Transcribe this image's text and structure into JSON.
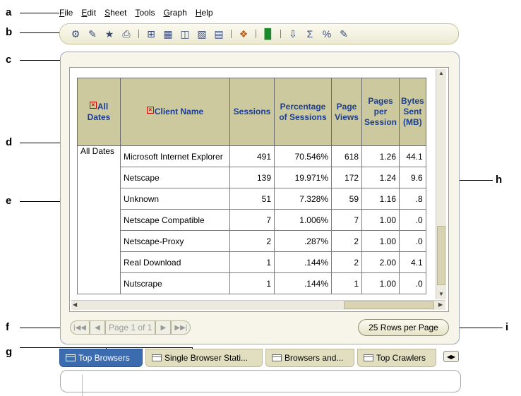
{
  "callouts": [
    "a",
    "b",
    "c",
    "d",
    "e",
    "f",
    "g",
    "h",
    "i"
  ],
  "menu": [
    {
      "underline": "F",
      "rest": "ile"
    },
    {
      "underline": "E",
      "rest": "dit"
    },
    {
      "underline": "S",
      "rest": "heet"
    },
    {
      "underline": "T",
      "rest": "ools"
    },
    {
      "underline": "G",
      "rest": "raph"
    },
    {
      "underline": "H",
      "rest": "elp"
    }
  ],
  "toolbar_icons": [
    "connect-icon",
    "save-icon",
    "edit-icon",
    "print-icon",
    "pivot-icon",
    "table-icon",
    "crosstab-icon",
    "format-icon",
    "columns-icon",
    "sort-icon",
    "graph-icon",
    "export-icon",
    "sum-icon",
    "percent-icon",
    "calculator-icon"
  ],
  "table": {
    "headers": [
      "All Dates",
      "Client Name",
      "Sessions",
      "Percentage of Sessions",
      "Page Views",
      "Pages per Session",
      "Bytes Sent (MB)"
    ],
    "dimension_label": "All Dates",
    "rows": [
      {
        "client": "Microsoft Internet Explorer",
        "sessions": "491",
        "pct": "70.546%",
        "views": "618",
        "pps": "1.26",
        "bytes": "44.1"
      },
      {
        "client": "Netscape",
        "sessions": "139",
        "pct": "19.971%",
        "views": "172",
        "pps": "1.24",
        "bytes": "9.6"
      },
      {
        "client": "Unknown",
        "sessions": "51",
        "pct": "7.328%",
        "views": "59",
        "pps": "1.16",
        "bytes": ".8"
      },
      {
        "client": "Netscape Compatible",
        "sessions": "7",
        "pct": "1.006%",
        "views": "7",
        "pps": "1.00",
        "bytes": ".0"
      },
      {
        "client": "Netscape-Proxy",
        "sessions": "2",
        "pct": ".287%",
        "views": "2",
        "pps": "1.00",
        "bytes": ".0"
      },
      {
        "client": "Real Download",
        "sessions": "1",
        "pct": ".144%",
        "views": "2",
        "pps": "2.00",
        "bytes": "4.1"
      },
      {
        "client": "Nutscrape",
        "sessions": "1",
        "pct": ".144%",
        "views": "1",
        "pps": "1.00",
        "bytes": ".0"
      }
    ]
  },
  "pager": {
    "label": "Page 1 of 1",
    "rows_per_page": "25 Rows per Page"
  },
  "tabs": [
    "Top Browsers",
    "Single Browser Stati...",
    "Browsers and...",
    "Top Crawlers"
  ],
  "colors": {
    "header_bg": "#cdc99f",
    "header_text": "#1a3e93",
    "active_tab": "#3b6cb0"
  }
}
